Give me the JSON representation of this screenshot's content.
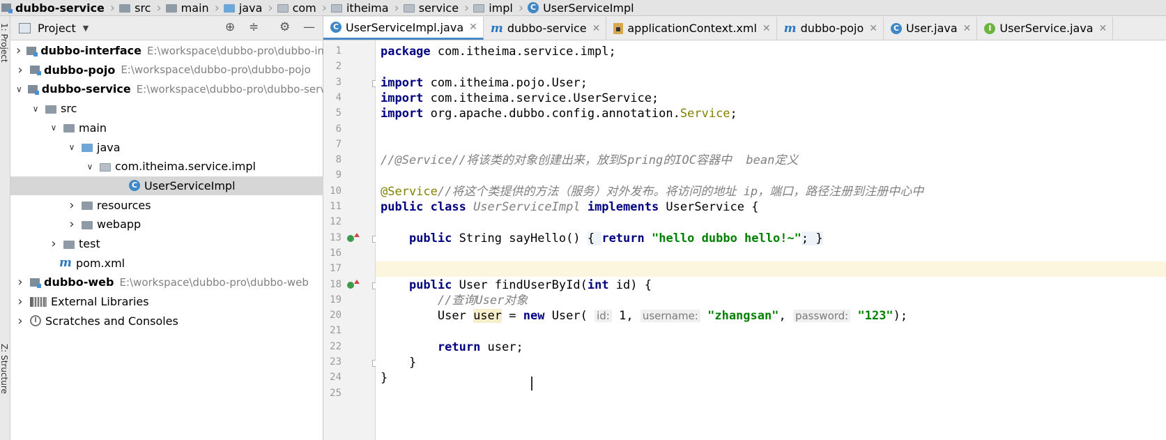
{
  "breadcrumb": [
    {
      "label": "dubbo-service",
      "icon": "module-icon"
    },
    {
      "label": "src",
      "icon": "folder-icon"
    },
    {
      "label": "main",
      "icon": "folder-icon"
    },
    {
      "label": "java",
      "icon": "source-folder-icon"
    },
    {
      "label": "com",
      "icon": "package-icon"
    },
    {
      "label": "itheima",
      "icon": "package-icon"
    },
    {
      "label": "service",
      "icon": "package-icon"
    },
    {
      "label": "impl",
      "icon": "package-icon"
    },
    {
      "label": "UserServiceImpl",
      "icon": "class-icon"
    }
  ],
  "left_stripe": {
    "project_tab": "1: Project",
    "structure_tab": "Z: Structure"
  },
  "project_panel": {
    "title": "Project",
    "tree": [
      {
        "label": "dubbo-interface",
        "path": "E:\\workspace\\dubbo-pro\\dubbo-interface",
        "icon": "module-icon",
        "arrow": "collapsed",
        "bold": true
      },
      {
        "label": "dubbo-pojo",
        "path": "E:\\workspace\\dubbo-pro\\dubbo-pojo",
        "icon": "module-icon",
        "arrow": "collapsed",
        "bold": true
      },
      {
        "label": "dubbo-service",
        "path": "E:\\workspace\\dubbo-pro\\dubbo-service",
        "icon": "module-icon",
        "arrow": "expanded",
        "bold": true
      },
      {
        "label": "src",
        "path": "",
        "icon": "folder-icon",
        "arrow": "expanded",
        "bold": false
      },
      {
        "label": "main",
        "path": "",
        "icon": "folder-icon",
        "arrow": "expanded",
        "bold": false
      },
      {
        "label": "java",
        "path": "",
        "icon": "source-folder-icon",
        "arrow": "expanded",
        "bold": false
      },
      {
        "label": "com.itheima.service.impl",
        "path": "",
        "icon": "package-icon",
        "arrow": "expanded",
        "bold": false
      },
      {
        "label": "UserServiceImpl",
        "path": "",
        "icon": "class-icon",
        "arrow": "none",
        "bold": false,
        "selected": true
      },
      {
        "label": "resources",
        "path": "",
        "icon": "resources-folder-icon",
        "arrow": "collapsed",
        "bold": false
      },
      {
        "label": "webapp",
        "path": "",
        "icon": "web-folder-icon",
        "arrow": "collapsed",
        "bold": false
      },
      {
        "label": "test",
        "path": "",
        "icon": "folder-icon",
        "arrow": "collapsed",
        "bold": false
      },
      {
        "label": "pom.xml",
        "path": "",
        "icon": "maven-icon",
        "arrow": "none",
        "bold": false
      },
      {
        "label": "dubbo-web",
        "path": "E:\\workspace\\dubbo-pro\\dubbo-web",
        "icon": "module-icon",
        "arrow": "collapsed",
        "bold": true
      },
      {
        "label": "External Libraries",
        "path": "",
        "icon": "library-icon",
        "arrow": "collapsed",
        "bold": false
      },
      {
        "label": "Scratches and Consoles",
        "path": "",
        "icon": "scratches-icon",
        "arrow": "collapsed",
        "bold": false
      }
    ]
  },
  "editor_tabs": [
    {
      "label": "UserServiceImpl.java",
      "icon": "class-icon",
      "active": true
    },
    {
      "label": "dubbo-service",
      "icon": "maven-icon",
      "active": false
    },
    {
      "label": "applicationContext.xml",
      "icon": "xml-icon",
      "active": false
    },
    {
      "label": "dubbo-pojo",
      "icon": "maven-icon",
      "active": false
    },
    {
      "label": "User.java",
      "icon": "class-icon",
      "active": false
    },
    {
      "label": "UserService.java",
      "icon": "interface-icon",
      "active": false
    }
  ],
  "code": {
    "line_numbers": [
      "1",
      "2",
      "3",
      "4",
      "5",
      "6",
      "7",
      "8",
      "9",
      "10",
      "11",
      "12",
      "13",
      "16",
      "17",
      "18",
      "19",
      "20",
      "21",
      "22",
      "23",
      "24",
      "25"
    ],
    "lines": [
      {
        "n": "1",
        "segs": [
          {
            "t": "package ",
            "c": "kw"
          },
          {
            "t": "com.itheima.service.impl;",
            "c": ""
          }
        ]
      },
      {
        "n": "2",
        "segs": []
      },
      {
        "n": "3",
        "segs": [
          {
            "t": "import ",
            "c": "kw"
          },
          {
            "t": "com.itheima.pojo.User;",
            "c": ""
          }
        ]
      },
      {
        "n": "4",
        "segs": [
          {
            "t": "import ",
            "c": "kw"
          },
          {
            "t": "com.itheima.service.UserService;",
            "c": ""
          }
        ]
      },
      {
        "n": "5",
        "segs": [
          {
            "t": "import ",
            "c": "kw"
          },
          {
            "t": "org.apache.dubbo.config.annotation.",
            "c": ""
          },
          {
            "t": "Service",
            "c": "ann"
          },
          {
            "t": ";",
            "c": ""
          }
        ]
      },
      {
        "n": "6",
        "segs": []
      },
      {
        "n": "7",
        "segs": []
      },
      {
        "n": "8",
        "segs": [
          {
            "t": "//@Service//将该类的对象创建出来，放到Spring的IOC容器中  bean定义",
            "c": "cmt"
          }
        ]
      },
      {
        "n": "9",
        "segs": []
      },
      {
        "n": "10",
        "segs": [
          {
            "t": "@Service",
            "c": "ann"
          },
          {
            "t": "//将这个类提供的方法（服务）对外发布。将访问的地址 ip，端口，路径注册到注册中心中",
            "c": "cmt"
          }
        ]
      },
      {
        "n": "11",
        "segs": [
          {
            "t": "public class ",
            "c": "kw"
          },
          {
            "t": "UserServiceImpl ",
            "c": "cmt"
          },
          {
            "t": "implements ",
            "c": "kw"
          },
          {
            "t": "UserService {",
            "c": ""
          }
        ]
      },
      {
        "n": "12",
        "segs": []
      },
      {
        "n": "13",
        "segs": [
          {
            "t": "    ",
            "c": ""
          },
          {
            "t": "public ",
            "c": "kw"
          },
          {
            "t": "String sayHello() ",
            "c": ""
          },
          {
            "t": "{ ",
            "c": "fold-blk"
          },
          {
            "t": "return ",
            "c": "kw"
          },
          {
            "t": "\"hello dubbo hello!~\"",
            "c": "str"
          },
          {
            "t": "; }",
            "c": "fold-blk"
          }
        ]
      },
      {
        "n": "16",
        "segs": []
      },
      {
        "n": "17",
        "segs": [],
        "current": true
      },
      {
        "n": "18",
        "segs": [
          {
            "t": "    ",
            "c": ""
          },
          {
            "t": "public ",
            "c": "kw"
          },
          {
            "t": "User findUserById(",
            "c": ""
          },
          {
            "t": "int ",
            "c": "kw"
          },
          {
            "t": "id) {",
            "c": ""
          }
        ]
      },
      {
        "n": "19",
        "segs": [
          {
            "t": "        ",
            "c": ""
          },
          {
            "t": "//查询User对象",
            "c": "cmt"
          }
        ]
      },
      {
        "n": "20",
        "segs": [
          {
            "t": "        User ",
            "c": ""
          },
          {
            "t": "user",
            "c": "var"
          },
          {
            "t": " = ",
            "c": ""
          },
          {
            "t": "new ",
            "c": "kw"
          },
          {
            "t": "User( ",
            "c": ""
          },
          {
            "t": "id:",
            "c": "hint"
          },
          {
            "t": " 1, ",
            "c": ""
          },
          {
            "t": "username:",
            "c": "hint"
          },
          {
            "t": " ",
            "c": ""
          },
          {
            "t": "\"zhangsan\"",
            "c": "str"
          },
          {
            "t": ", ",
            "c": ""
          },
          {
            "t": "password:",
            "c": "hint"
          },
          {
            "t": " ",
            "c": ""
          },
          {
            "t": "\"123\"",
            "c": "str"
          },
          {
            "t": ");",
            "c": ""
          }
        ]
      },
      {
        "n": "21",
        "segs": []
      },
      {
        "n": "22",
        "segs": [
          {
            "t": "        ",
            "c": ""
          },
          {
            "t": "return ",
            "c": "kw"
          },
          {
            "t": "user;",
            "c": ""
          }
        ]
      },
      {
        "n": "23",
        "segs": [
          {
            "t": "    }",
            "c": ""
          }
        ]
      },
      {
        "n": "24",
        "segs": [
          {
            "t": "}",
            "c": ""
          }
        ]
      },
      {
        "n": "25",
        "segs": []
      }
    ]
  },
  "colors": {
    "keyword": "#000080",
    "string": "#008000",
    "annotation": "#808000",
    "comment": "#808080",
    "selection": "#d6d6d6",
    "tab_accent": "#4a88c7",
    "caret_line": "#fdf6df"
  }
}
